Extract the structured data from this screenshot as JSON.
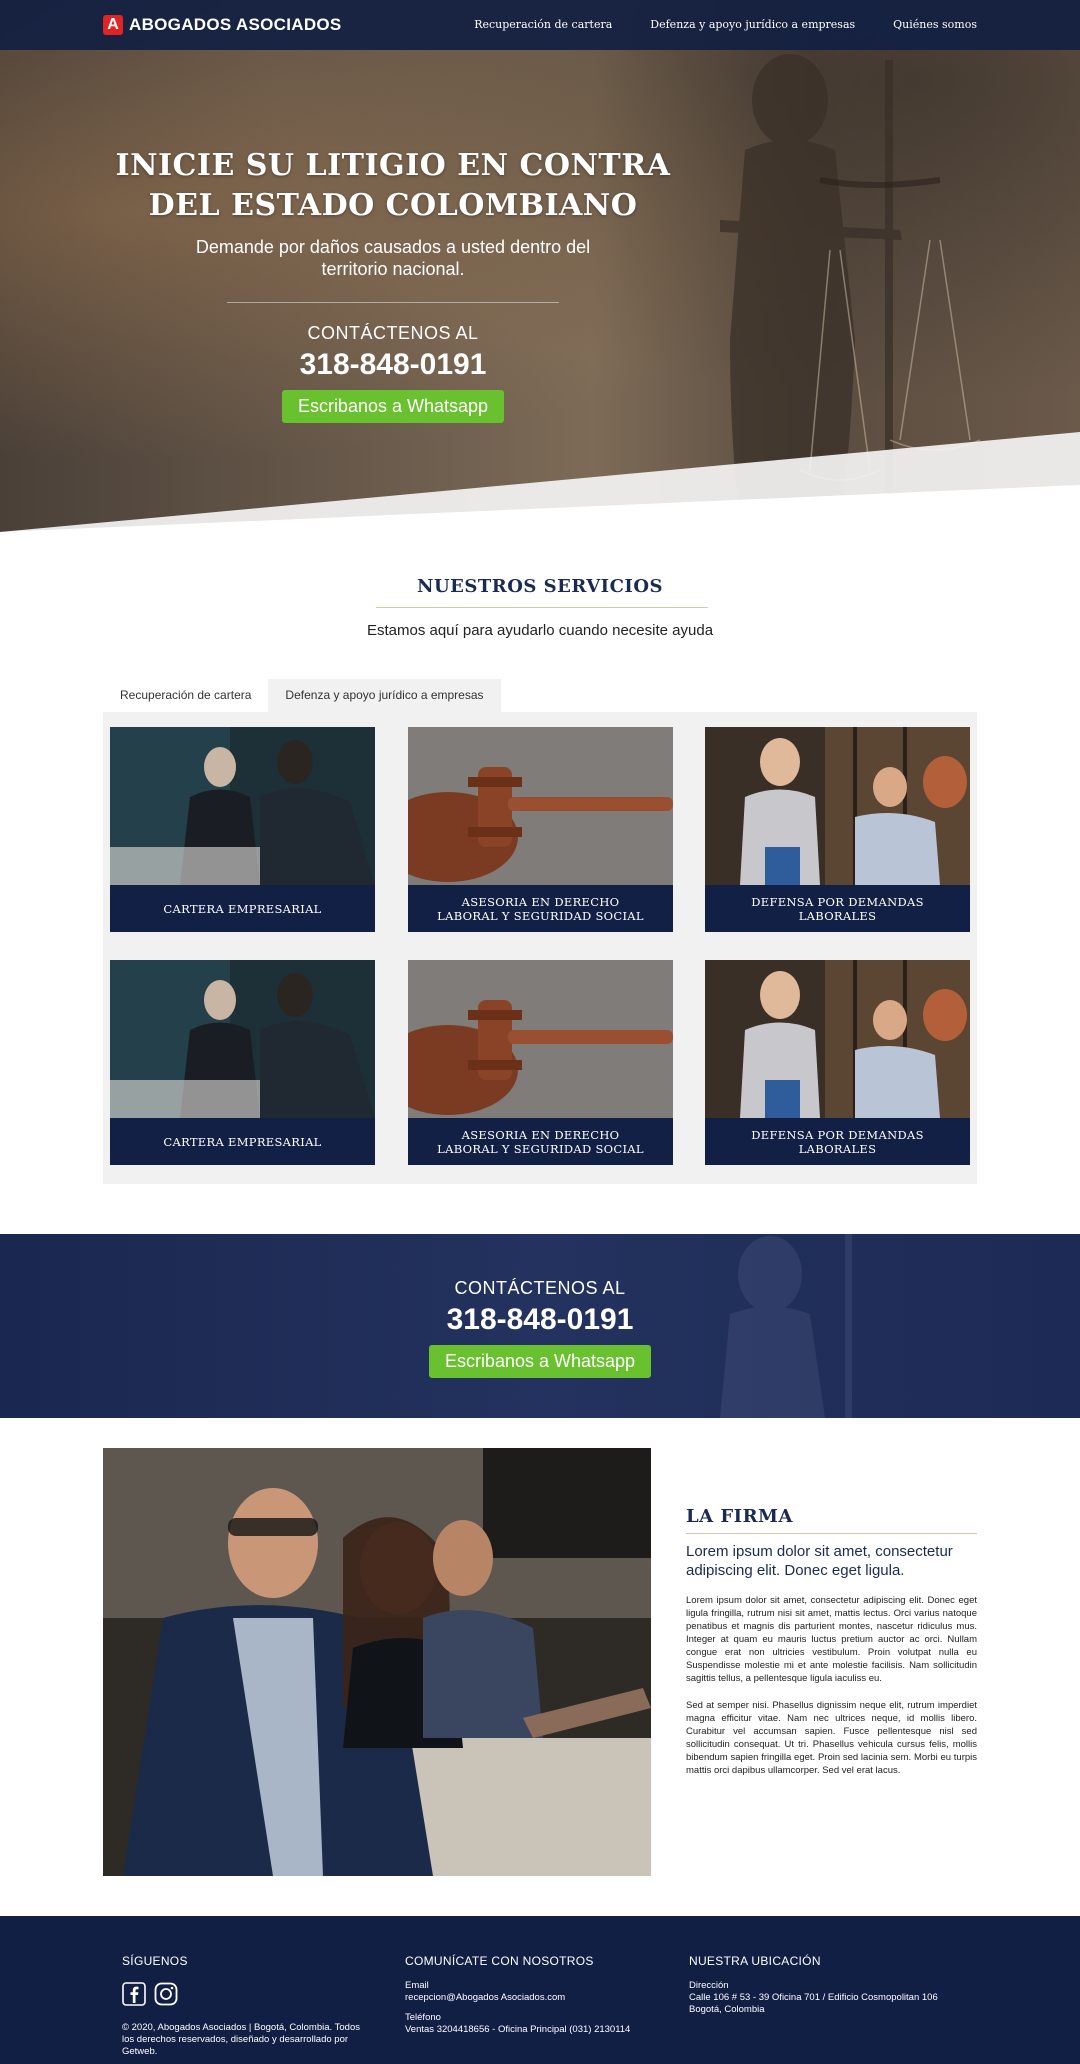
{
  "nav": {
    "brand": "ABOGADOS ASOCIADOS",
    "brand_icon": "A",
    "links": [
      "Recuperación de cartera",
      "Defenza y apoyo jurídico a empresas",
      "Quiénes somos"
    ]
  },
  "hero": {
    "title": "INICIE SU LITIGIO EN CONTRA DEL ESTADO COLOMBIANO",
    "subtitle": "Demande por daños causados a usted dentro del territorio nacional.",
    "contact_label": "CONTÁCTENOS AL",
    "phone": "318-848-0191",
    "whatsapp_button": "Escribanos a Whatsapp"
  },
  "services": {
    "title": "NUESTROS SERVICIOS",
    "subtitle": "Estamos aquí para ayudarlo cuando necesite ayuda",
    "tabs": [
      "Recuperación de cartera",
      "Defenza y apoyo jurídico a empresas"
    ],
    "active_tab": 1,
    "cards": [
      "CARTERA EMPRESARIAL",
      "ASESORIA EN DERECHO LABORAL Y SEGURIDAD SOCIAL",
      "DEFENSA POR DEMANDAS LABORALES",
      "CARTERA EMPRESARIAL",
      "ASESORIA EN DERECHO LABORAL Y SEGURIDAD SOCIAL",
      "DEFENSA POR DEMANDAS LABORALES"
    ]
  },
  "cta": {
    "contact_label": "CONTÁCTENOS AL",
    "phone": "318-848-0191",
    "whatsapp_button": "Escribanos a Whatsapp"
  },
  "firm": {
    "title": "LA FIRMA",
    "lead": "Lorem ipsum dolor sit amet, consectetur adipiscing elit. Donec eget ligula.",
    "p1": "Lorem ipsum dolor sit amet, consectetur adipiscing elit. Donec eget ligula fringilla, rutrum nisi sit amet, mattis lectus. Orci varius natoque penatibus et magnis dis parturient montes, nascetur ridiculus mus. Integer at quam eu mauris luctus pretium auctor ac orci. Nullam congue erat non ultricies vestibulum. Proin volutpat nulla eu  Suspendisse molestie mi et ante molestie facilisis. Nam sollicitudin sagittis tellus, a pellentesque ligula iaculiss eu.",
    "p2": "Sed at semper nisi. Phasellus dignissim neque elit, rutrum imperdiet magna efficitur vitae. Nam nec ultrices neque, id mollis libero. Curabitur vel accumsan sapien. Fusce pellentesque nisl sed sollicitudin consequat. Ut tri. Phasellus vehicula cursus felis, mollis bibendum sapien fringilla eget. Proin sed lacinia sem. Morbi eu turpis mattis orci dapibus ullamcorper. Sed vel erat lacus."
  },
  "footer": {
    "follow_title": "SÍGUENOS",
    "social_icons": [
      "facebook-icon",
      "instagram-icon"
    ],
    "copyright": "© 2020, Abogados Asociados | Bogotá, Colombia. Todos los derechos reservados, diseñado y desarrollado por Getweb.",
    "contact_title": "COMUNÍCATE CON NOSOTROS",
    "email_label": "Email",
    "email": "recepcion@Abogados Asociados.com",
    "phone_label": "Teléfono",
    "phones": "Ventas 3204418656 - Oficina Principal (031) 2130114",
    "location_title": "NUESTRA UBICACIÓN",
    "address_label": "Dirección",
    "address": "Calle 106 # 53 - 39 Oficina 701 / Edificio Cosmopolitan 106",
    "city": "Bogotá, Colombia"
  },
  "colors": {
    "navy": "#121f45",
    "whatsapp_green": "#6ac12f",
    "brand_red": "#e02424",
    "accent_gold": "#d8c7a8"
  }
}
